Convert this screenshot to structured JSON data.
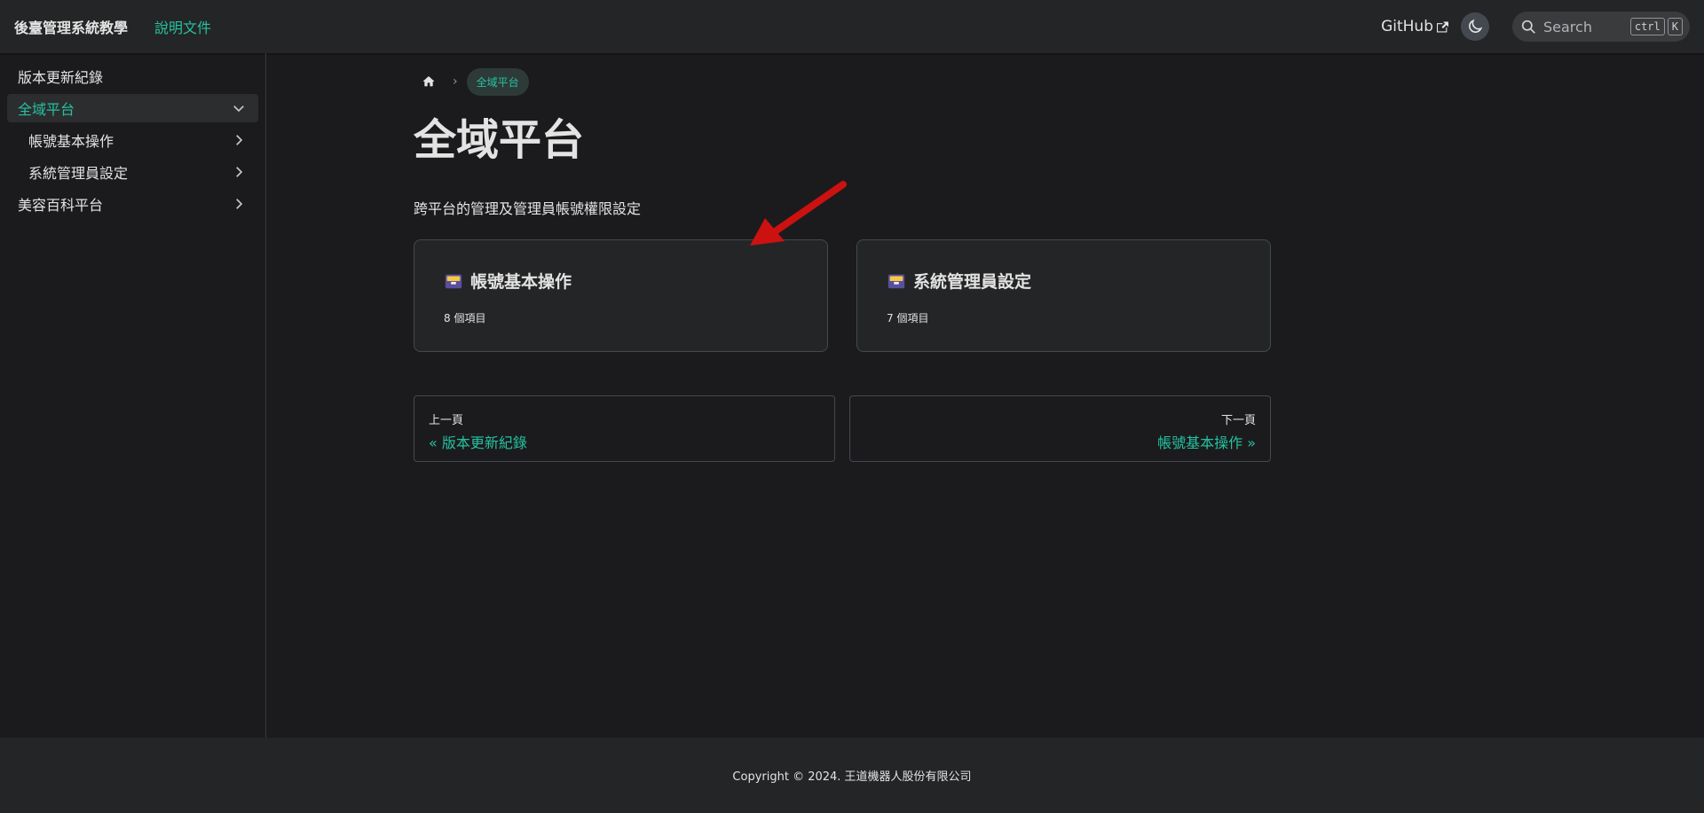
{
  "navbar": {
    "brand": "後臺管理系統教學",
    "docs_link": "說明文件",
    "github_label": "GitHub",
    "search_placeholder": "Search",
    "search_key_1": "ctrl",
    "search_key_2": "K"
  },
  "sidebar": {
    "items": [
      {
        "label": "版本更新紀錄"
      },
      {
        "label": "全域平台"
      },
      {
        "label": "帳號基本操作"
      },
      {
        "label": "系統管理員設定"
      },
      {
        "label": "美容百科平台"
      }
    ]
  },
  "breadcrumb": {
    "current": "全域平台"
  },
  "main": {
    "title": "全域平台",
    "description": "跨平台的管理及管理員帳號權限設定",
    "cards": [
      {
        "title": "帳號基本操作",
        "count": "8 個項目",
        "icon": "card-index-icon"
      },
      {
        "title": "系統管理員設定",
        "count": "7 個項目",
        "icon": "card-index-icon"
      }
    ]
  },
  "pager": {
    "prev_sub": "上一頁",
    "prev_label": "« 版本更新紀錄",
    "next_sub": "下一頁",
    "next_label": "帳號基本操作 »"
  },
  "footer": {
    "copyright": "Copyright © 2024. 王道機器人股份有限公司"
  },
  "colors": {
    "accent": "#25c2a0",
    "arrow": "#cc1111"
  }
}
